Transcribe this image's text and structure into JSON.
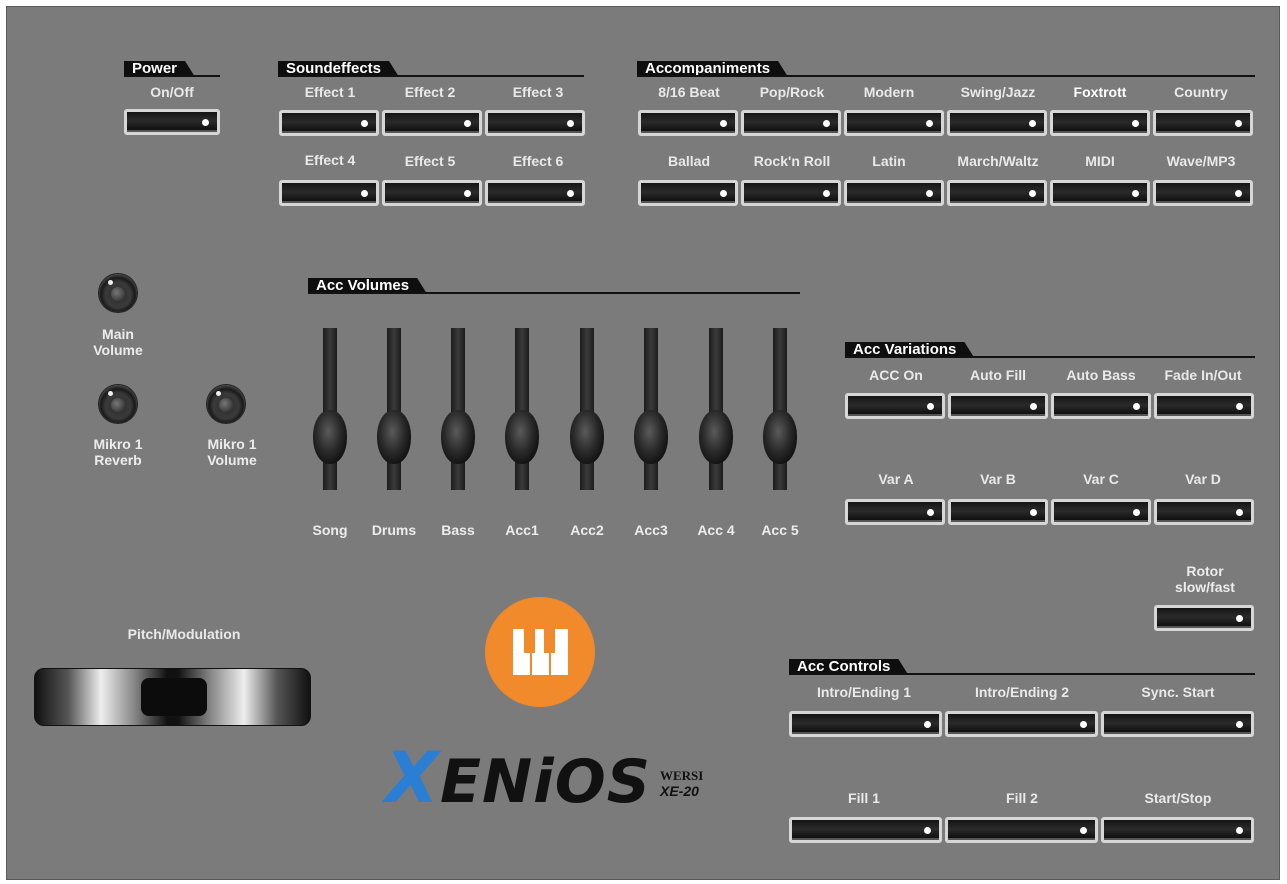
{
  "colors": {
    "panel": "#7b7b7b",
    "logo_orange": "#f08a2a",
    "brand_blue": "#2a7fd4"
  },
  "power": {
    "title": "Power",
    "labels": [
      "On/Off"
    ]
  },
  "soundeffects": {
    "title": "Soundeffects",
    "labels": [
      "Effect 1",
      "Effect 2",
      "Effect 3",
      "Effect 4",
      "Effect 5",
      "Effect 6"
    ]
  },
  "accompaniments": {
    "title": "Accompaniments",
    "labels": [
      "8/16 Beat",
      "Pop/Rock",
      "Modern",
      "Swing/Jazz",
      "Foxtrott",
      "Country",
      "Ballad",
      "Rock'n Roll",
      "Latin",
      "March/Waltz",
      "MIDI",
      "Wave/MP3"
    ]
  },
  "knobs": {
    "main": [
      "Main",
      "Volume"
    ],
    "reverb": [
      "Mikro 1",
      "Reverb"
    ],
    "mic_volume": [
      "Mikro 1",
      "Volume"
    ]
  },
  "acc_volumes": {
    "title": "Acc Volumes",
    "labels": [
      "Song",
      "Drums",
      "Bass",
      "Acc1",
      "Acc2",
      "Acc3",
      "Acc 4",
      "Acc 5"
    ]
  },
  "acc_variations": {
    "title": "Acc Variations",
    "labels": [
      "ACC On",
      "Auto Fill",
      "Auto Bass",
      "Fade In/Out",
      "Var A",
      "Var B",
      "Var C",
      "Var D"
    ]
  },
  "rotor": [
    "Rotor",
    "slow/fast"
  ],
  "pitch": {
    "label": "Pitch/Modulation"
  },
  "acc_controls": {
    "title": "Acc Controls",
    "labels": [
      "Intro/Ending 1",
      "Intro/Ending 2",
      "Sync. Start",
      "Fill 1",
      "Fill 2",
      "Start/Stop"
    ]
  },
  "brand": {
    "x": "X",
    "rest": "ENiOS",
    "maker": "WERSI",
    "model": "XE-20"
  }
}
